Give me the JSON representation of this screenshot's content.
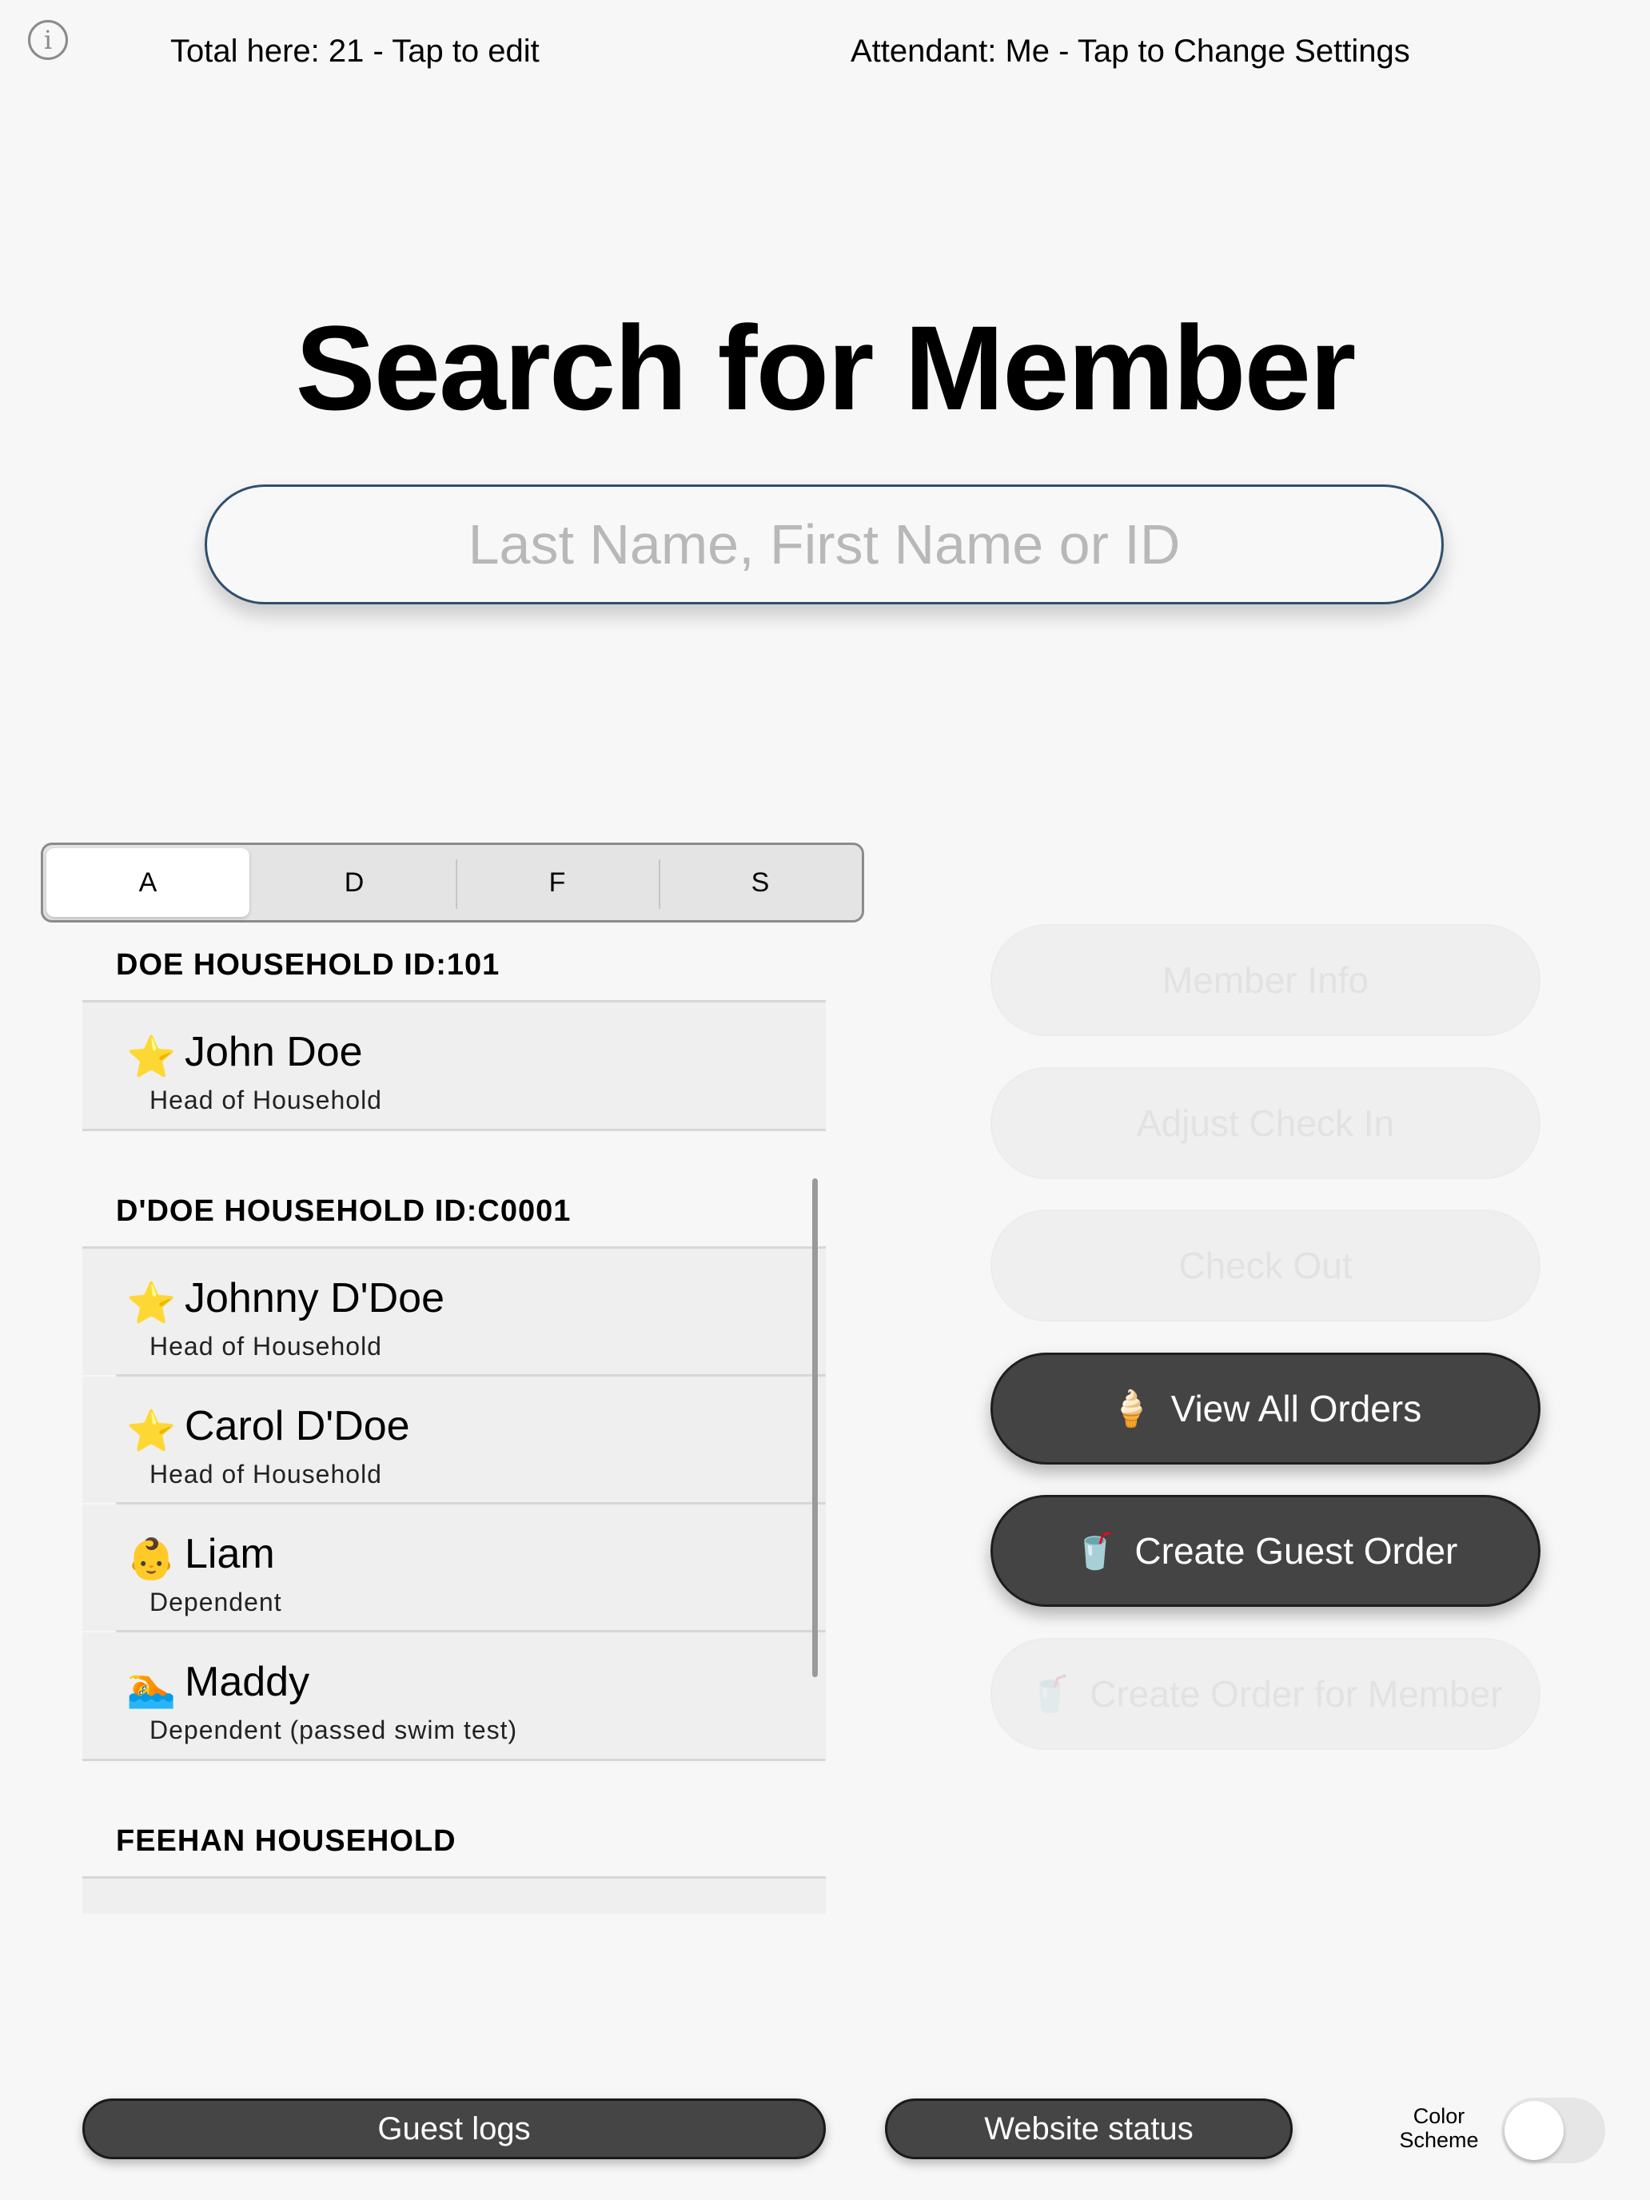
{
  "header": {
    "total_text": "Total here: 21 - Tap to edit",
    "attendant_text": "Attendant: Me - Tap to Change Settings",
    "info_icon": "info-icon"
  },
  "main": {
    "title": "Search for Member",
    "search_placeholder": "Last Name, First Name or ID"
  },
  "tabs": [
    "A",
    "D",
    "F",
    "S"
  ],
  "selected_tab": "A",
  "list": {
    "sections": [
      {
        "header": "DOE  HOUSEHOLD ID:101",
        "members": [
          {
            "emoji": "⭐",
            "name": "John Doe",
            "role": "Head of Household"
          }
        ]
      },
      {
        "header": "D'DOE HOUSEHOLD ID:C0001",
        "members": [
          {
            "emoji": "⭐",
            "name": "Johnny D'Doe",
            "role": "Head of Household"
          },
          {
            "emoji": "⭐",
            "name": "Carol D'Doe",
            "role": "Head of Household"
          },
          {
            "emoji": "👶",
            "name": "Liam",
            "role": "Dependent"
          },
          {
            "emoji": "🏊",
            "name": "Maddy",
            "role": "Dependent (passed swim test)"
          }
        ]
      },
      {
        "header": "FEEHAN HOUSEHOLD",
        "members": []
      }
    ]
  },
  "actions": {
    "member_info": "Member Info",
    "adjust_check_in": "Adjust Check In",
    "check_out": "Check Out",
    "view_all_orders": {
      "emoji": "🍦",
      "label": "View All Orders"
    },
    "create_guest_order": {
      "emoji": "🥤",
      "label": "Create Guest Order"
    },
    "create_order_for_member": {
      "emoji": "🥤",
      "label": "Create Order for Member"
    }
  },
  "footer": {
    "guest_logs": "Guest logs",
    "website_status": "Website status",
    "color_scheme_label": "Color Scheme",
    "color_scheme_on": false
  }
}
